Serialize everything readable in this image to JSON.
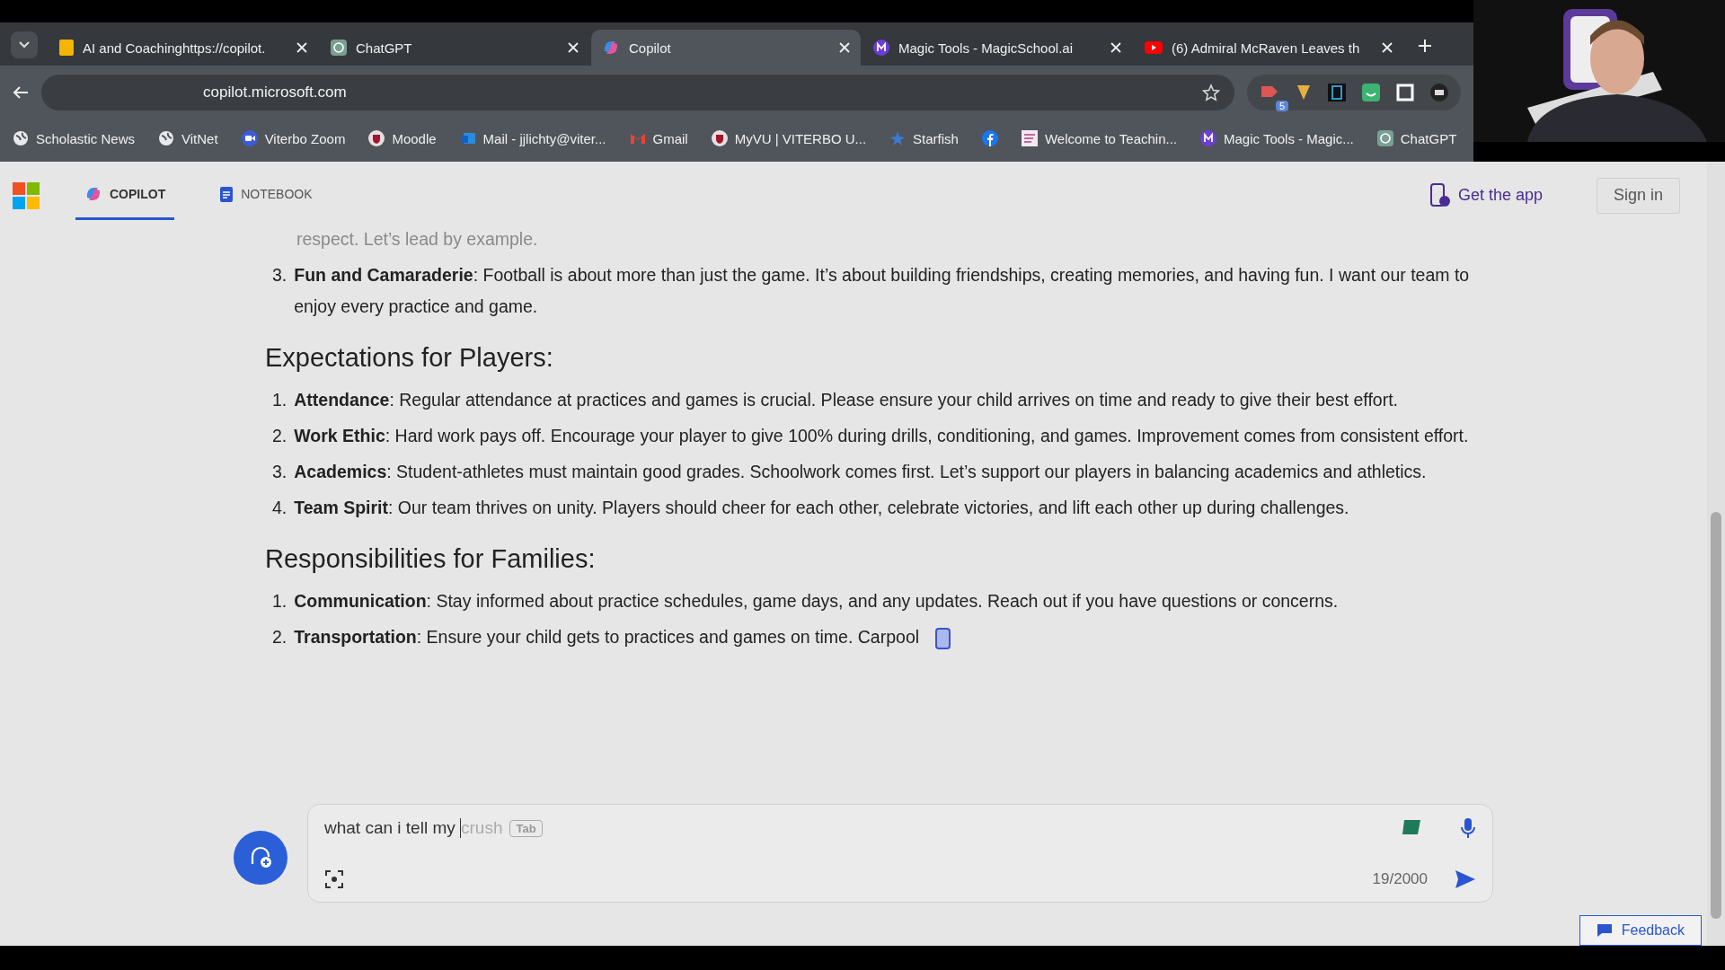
{
  "browser": {
    "tabs": [
      {
        "title": "AI and Coachinghttps://copilot.",
        "kind": "doc",
        "selected": false
      },
      {
        "title": "ChatGPT",
        "kind": "chatgpt",
        "selected": false
      },
      {
        "title": "Copilot",
        "kind": "copilot",
        "selected": true
      },
      {
        "title": "Magic Tools - MagicSchool.ai",
        "kind": "magic",
        "selected": false
      },
      {
        "title": "(6) Admiral McRaven Leaves th",
        "kind": "youtube",
        "selected": false
      }
    ],
    "address": "copilot.microsoft.com",
    "extension_badge": "5",
    "bookmarks": [
      {
        "label": "Scholastic News",
        "kind": "globe"
      },
      {
        "label": "VitNet",
        "kind": "globe"
      },
      {
        "label": "Viterbo Zoom",
        "kind": "zoom"
      },
      {
        "label": "Moodle",
        "kind": "crest"
      },
      {
        "label": "Mail - jjlichty@viter...",
        "kind": "mail"
      },
      {
        "label": "Gmail",
        "kind": "gmail"
      },
      {
        "label": "MyVU | VITERBO U...",
        "kind": "crest"
      },
      {
        "label": "Starfish",
        "kind": "star"
      },
      {
        "kind": "facebook"
      },
      {
        "label": "Welcome to Teachin...",
        "kind": "page"
      },
      {
        "label": "Magic Tools - Magic...",
        "kind": "magic"
      },
      {
        "label": "ChatGPT",
        "kind": "chatgpt"
      }
    ]
  },
  "header": {
    "nav": [
      {
        "label": "COPILOT",
        "kind": "copilot",
        "selected": true
      },
      {
        "label": "NOTEBOOK",
        "kind": "notebook",
        "selected": false
      }
    ],
    "get_app": "Get the app",
    "sign_in": "Sign in"
  },
  "response": {
    "faded_line": "respect. Let’s lead by example.",
    "top_list": [
      {
        "number": "3.",
        "text": "**Fun and Camaraderie**: Football is about more than just the game. It’s about building friendships, creating memories, and having fun. I want our team to enjoy every practice and game."
      }
    ],
    "sections": [
      {
        "heading": "Expectations for Players:",
        "items": [
          {
            "number": "1.",
            "text": "**Attendance**: Regular attendance at practices and games is crucial. Please ensure your child arrives on time and ready to give their best effort."
          },
          {
            "number": "2.",
            "text": "**Work Ethic**: Hard work pays off. Encourage your player to give 100% during drills, conditioning, and games. Improvement comes from consistent effort."
          },
          {
            "number": "3.",
            "text": "**Academics**: Student-athletes must maintain good grades. Schoolwork comes first. Let’s support our players in balancing academics and athletics."
          },
          {
            "number": "4.",
            "text": "**Team Spirit**: Our team thrives on unity. Players should cheer for each other, celebrate victories, and lift each other up during challenges."
          }
        ]
      },
      {
        "heading": "Responsibilities for Families:",
        "items": [
          {
            "number": "1.",
            "text": "**Communication**: Stay informed about practice schedules, game days, and any updates. Reach out if you have questions or concerns."
          },
          {
            "number": "2.",
            "text": "**Transportation**: Ensure your child gets to practices and games on time. Carpool",
            "streaming": true
          }
        ]
      }
    ]
  },
  "composer": {
    "value": "what can i tell my ",
    "suggestion": "crush",
    "hint_key": "Tab",
    "counter": "19/2000"
  },
  "feedback": "Feedback"
}
